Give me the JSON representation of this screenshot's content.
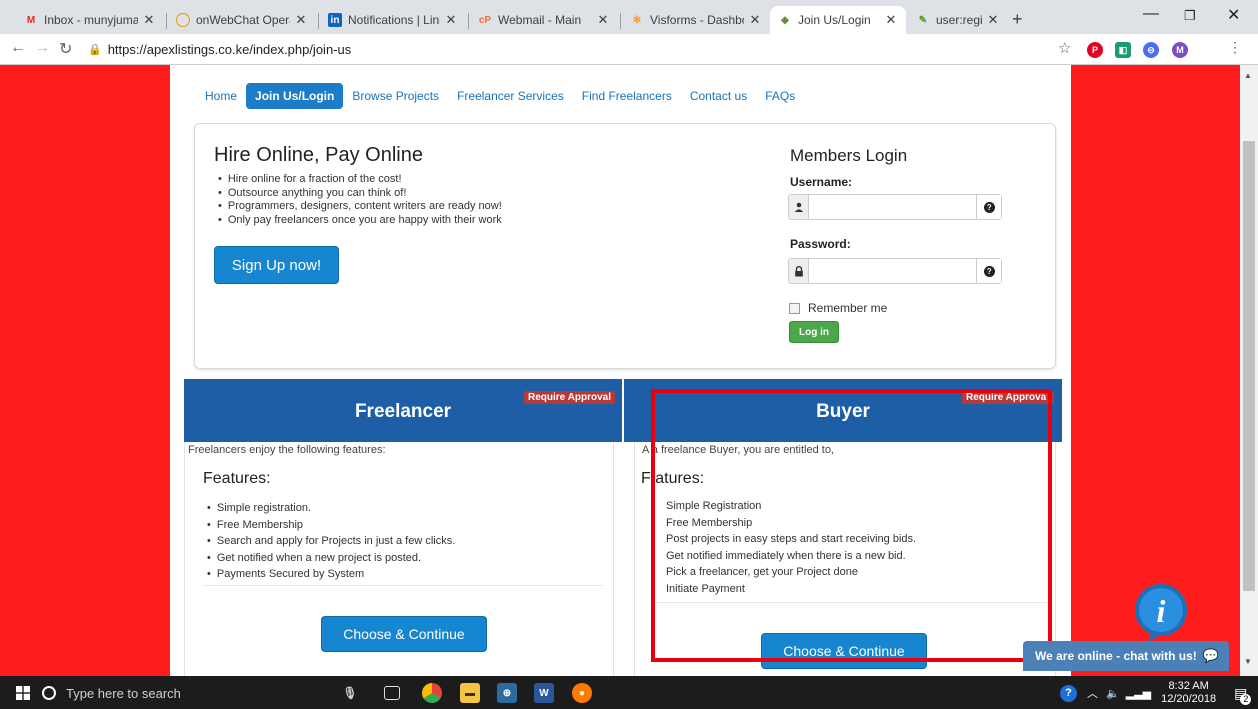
{
  "browser": {
    "tabs": [
      {
        "label": "Inbox - munyjuma",
        "icon": "gmail-icon",
        "active": false
      },
      {
        "label": "onWebChat Opera",
        "icon": "onwebchat-icon",
        "active": false
      },
      {
        "label": "Notifications | Link",
        "icon": "linkedin-icon",
        "active": false
      },
      {
        "label": "Webmail - Main",
        "icon": "cpanel-icon",
        "active": false
      },
      {
        "label": "Visforms - Dashbo",
        "icon": "joomla-icon",
        "active": false
      },
      {
        "label": "Join Us/Login",
        "icon": "leaf-icon",
        "active": true
      },
      {
        "label": "user:registration [",
        "icon": "joomla-edit-icon",
        "active": false
      }
    ],
    "url": "https://apexlistings.co.ke/index.php/join-us",
    "profile_initial": "M"
  },
  "nav": {
    "items": [
      "Home",
      "Join Us/Login",
      "Browse Projects",
      "Freelancer Services",
      "Find Freelancers",
      "Contact us",
      "FAQs"
    ],
    "active_index": 1
  },
  "hero": {
    "title": "Hire Online, Pay Online",
    "bullets": [
      "Hire online for a fraction of the cost!",
      "Outsource anything you can think of!",
      "Programmers, designers, content writers are ready now!",
      "Only pay freelancers once you are happy with their work"
    ],
    "signup_label": "Sign Up now!"
  },
  "login": {
    "title": "Members Login",
    "username_label": "Username:",
    "username_value": "",
    "password_label": "Password:",
    "password_value": "",
    "remember_label": "Remember me",
    "remember_checked": false,
    "login_label": "Log in"
  },
  "plans": {
    "freelancer": {
      "title": "Freelancer",
      "badge": "Require Approval",
      "intro": "Freelancers enjoy the following features:",
      "features_title": "Features:",
      "features": [
        "Simple registration.",
        "Free Membership",
        "Search and apply for Projects in just a few clicks.",
        "Get notified when a new project is posted.",
        "Payments Secured by System"
      ],
      "button_label": "Choose & Continue"
    },
    "buyer": {
      "title": "Buyer",
      "badge": "Require Approva",
      "intro": "A  a freelance Buyer, you are entitled to,",
      "features_title": "F atures:",
      "features": [
        "Simple Registration",
        "Free Membership",
        "Post projects in easy steps and start receiving bids.",
        "Get notified immediately when there is a new bid.",
        "Pick a freelancer, get your Project done",
        "Initiate Payment"
      ],
      "button_label": "Choose & Continue"
    }
  },
  "chat": {
    "bar_text": "We are online - chat with us!",
    "bubble_glyph": "i"
  },
  "taskbar": {
    "search_placeholder": "Type here to search",
    "time": "8:32 AM",
    "date": "12/20/2018",
    "notification_count": "2"
  },
  "colors": {
    "page_background": "#ff1c1c",
    "primary_button": "#1586cf",
    "plan_header": "#1e5ea6",
    "badge": "#b53a3a",
    "login_button": "#4aa84a",
    "highlight": "#e8000c"
  }
}
